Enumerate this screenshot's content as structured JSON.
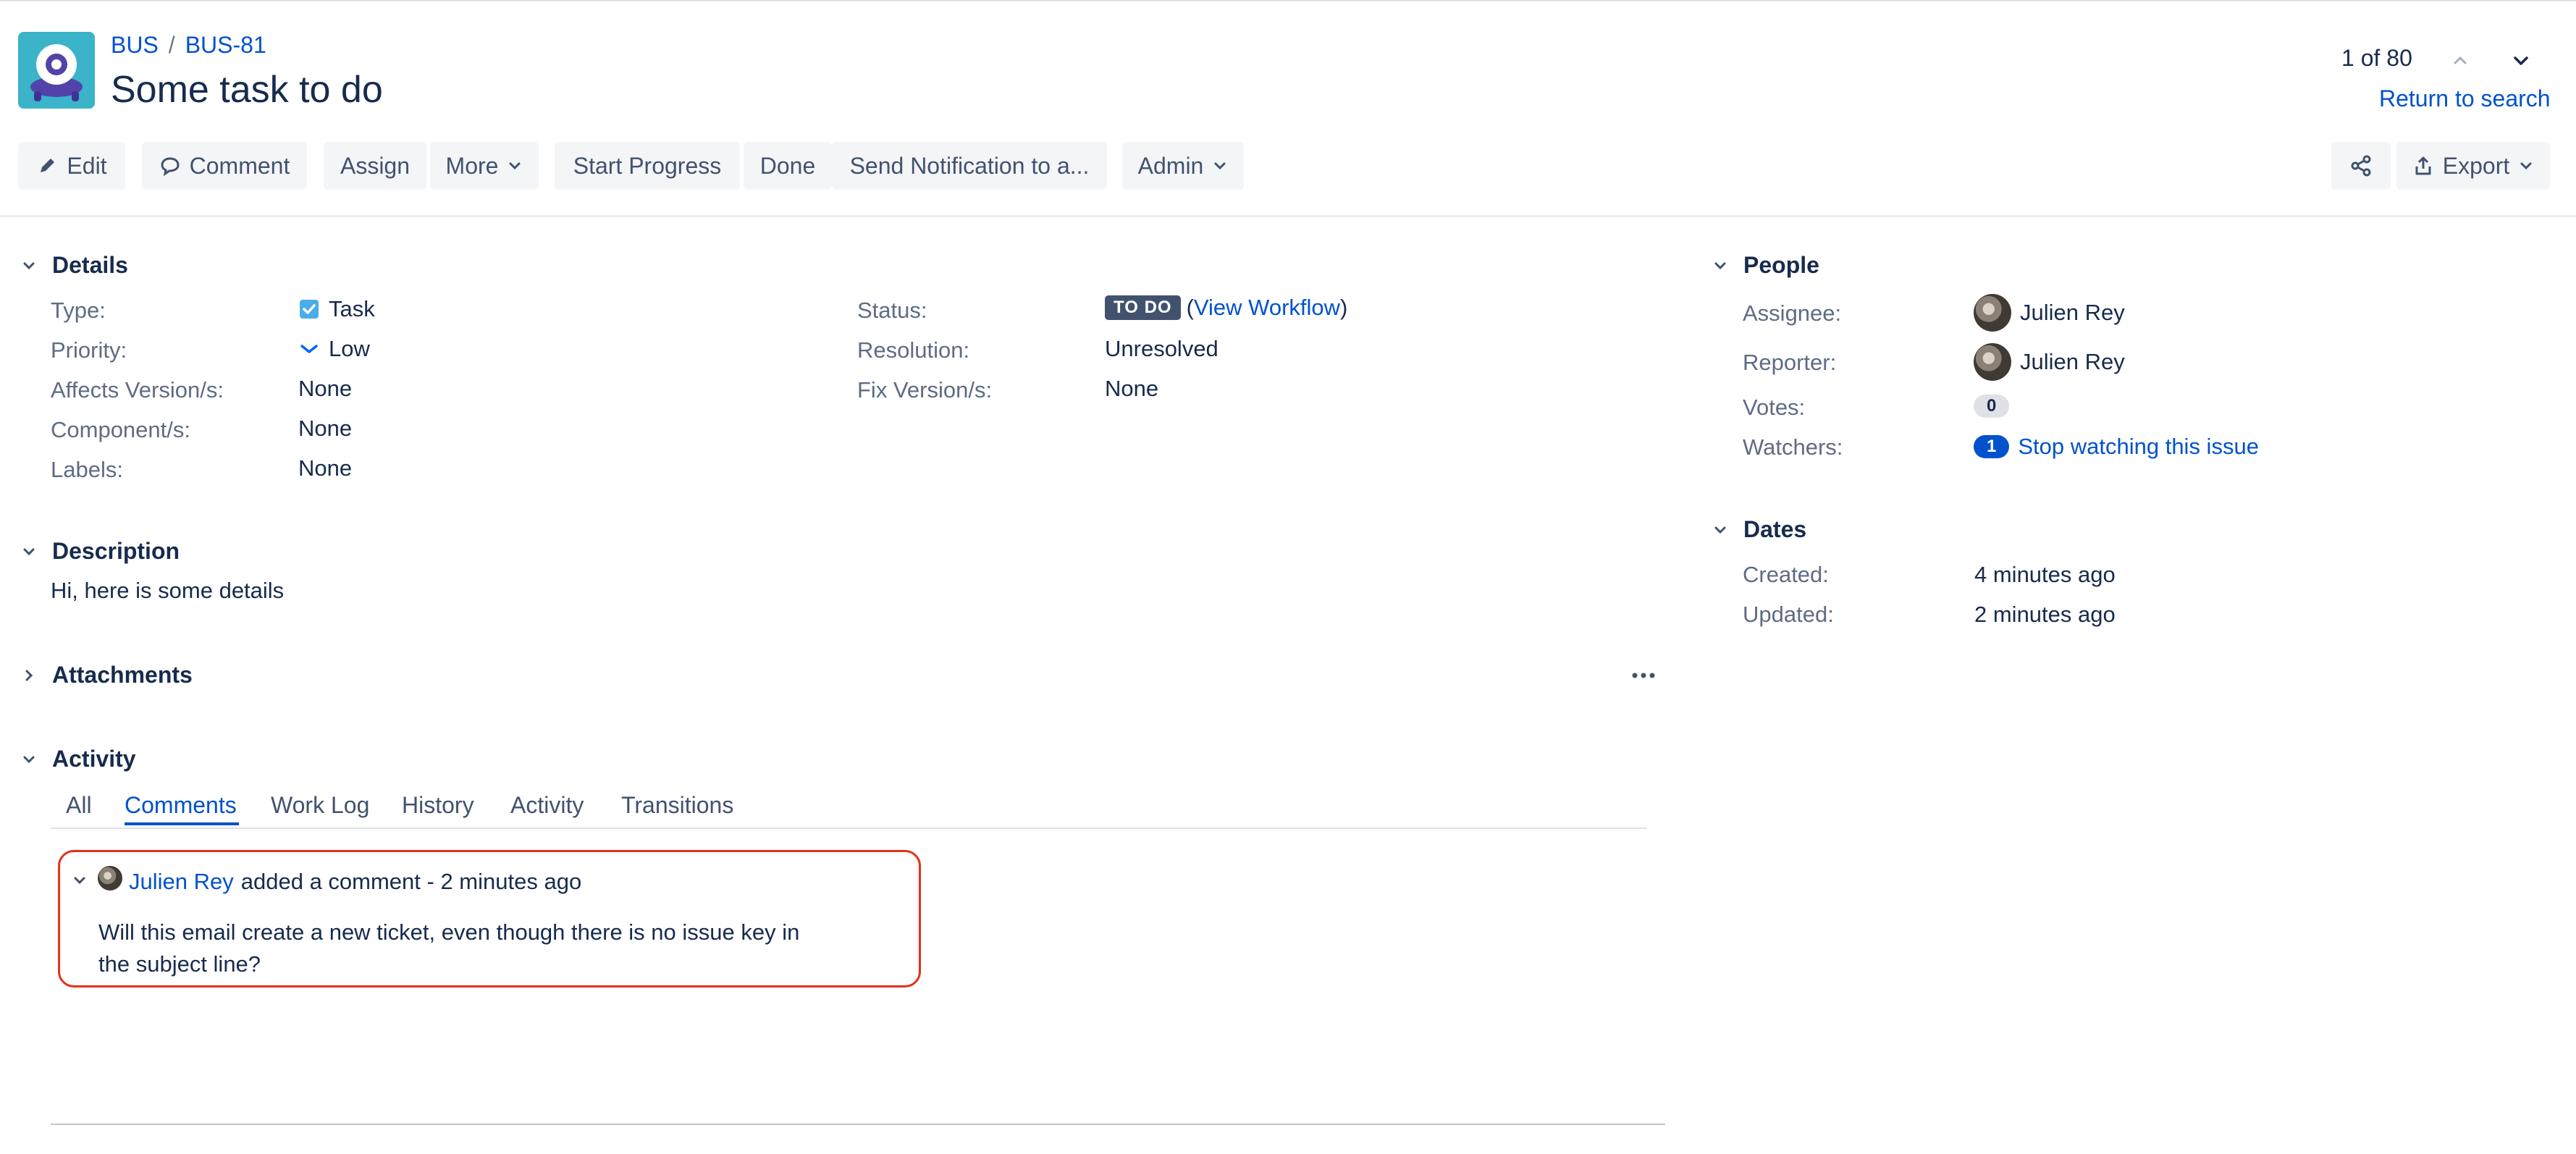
{
  "project": {
    "key": "BUS",
    "issue_key": "BUS-81",
    "separator": "/"
  },
  "issue": {
    "title": "Some task to do"
  },
  "pager": {
    "position": "1 of 80",
    "return_link": "Return to search"
  },
  "toolbar": {
    "edit": "Edit",
    "comment": "Comment",
    "assign": "Assign",
    "more": "More",
    "start_progress": "Start Progress",
    "done": "Done",
    "send_notification": "Send Notification to a...",
    "admin": "Admin",
    "export": "Export"
  },
  "details": {
    "heading": "Details",
    "left": [
      {
        "label": "Type:",
        "value": "Task"
      },
      {
        "label": "Priority:",
        "value": "Low"
      },
      {
        "label": "Affects Version/s:",
        "value": "None"
      },
      {
        "label": "Component/s:",
        "value": "None"
      },
      {
        "label": "Labels:",
        "value": "None"
      }
    ],
    "right": [
      {
        "label": "Status:",
        "value": "TO DO",
        "link_open": "(",
        "link": "View Workflow",
        "link_close": ")"
      },
      {
        "label": "Resolution:",
        "value": "Unresolved"
      },
      {
        "label": "Fix Version/s:",
        "value": "None"
      }
    ]
  },
  "description": {
    "heading": "Description",
    "text": "Hi, here is some details"
  },
  "attachments": {
    "heading": "Attachments"
  },
  "activity": {
    "heading": "Activity",
    "tabs": [
      "All",
      "Comments",
      "Work Log",
      "History",
      "Activity",
      "Transitions"
    ],
    "active_tab": "Comments",
    "comment": {
      "author": "Julien Rey",
      "meta": "added a comment - 2 minutes ago",
      "body_line1": "Will this email create a new ticket, even though there is no issue key in",
      "body_line2": "the subject line?"
    }
  },
  "people": {
    "heading": "People",
    "assignee_label": "Assignee:",
    "assignee": "Julien Rey",
    "reporter_label": "Reporter:",
    "reporter": "Julien Rey",
    "votes_label": "Votes:",
    "votes": "0",
    "watchers_label": "Watchers:",
    "watchers": "1",
    "watch_link": "Stop watching this issue"
  },
  "dates": {
    "heading": "Dates",
    "created_label": "Created:",
    "created": "4 minutes ago",
    "updated_label": "Updated:",
    "updated": "2 minutes ago"
  },
  "colors": {
    "link": "#0052cc",
    "text": "#172b4d",
    "muted": "#5e6c84",
    "button_bg": "#f4f5f7",
    "highlight": "#e2331b"
  }
}
